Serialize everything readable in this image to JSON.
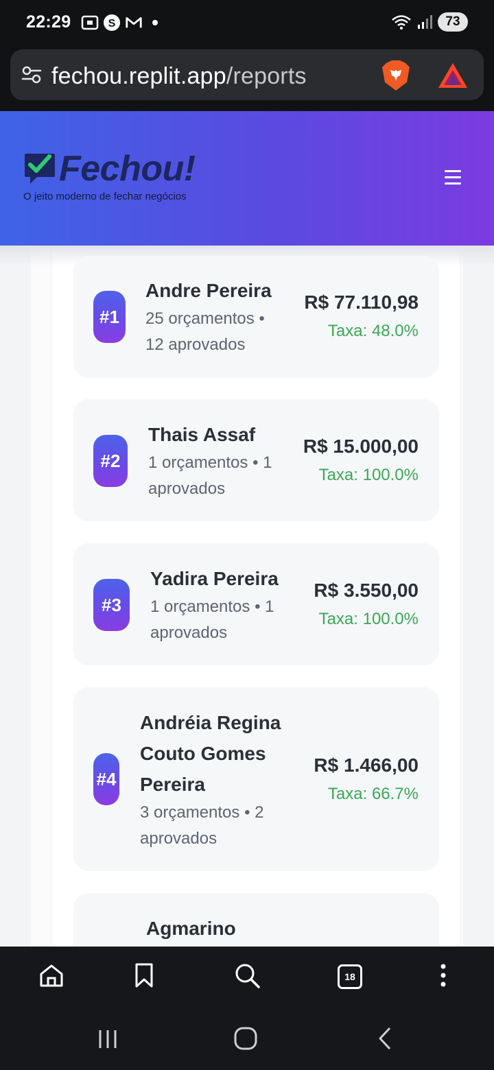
{
  "status_bar": {
    "time": "22:29",
    "battery": "73",
    "icons_left": [
      "screen-record-icon",
      "s-app-icon",
      "gmail-icon"
    ],
    "icons_right": [
      "wifi-icon",
      "signal-icon"
    ]
  },
  "browser": {
    "url_host": "fechou.replit.app",
    "url_path": "/reports",
    "tab_count": "18"
  },
  "app": {
    "logo_text": "Fechou!",
    "tagline": "O jeito moderno de fechar negócios",
    "colors": {
      "header_start": "#3f63e6",
      "header_end": "#7a3be0",
      "rate_green": "#3aa856"
    }
  },
  "ranking": [
    {
      "rank": "#1",
      "name": "Andre Pereira",
      "stats": "25 orçamentos • 12 aprovados",
      "amount": "R$ 77.110,98",
      "rate": "Taxa: 48.0%"
    },
    {
      "rank": "#2",
      "name": "Thais Assaf",
      "stats": "1 orçamentos • 1 aprovados",
      "amount": "R$ 15.000,00",
      "rate": "Taxa: 100.0%"
    },
    {
      "rank": "#3",
      "name": "Yadira Pereira",
      "stats": "1 orçamentos • 1 aprovados",
      "amount": "R$ 3.550,00",
      "rate": "Taxa: 100.0%"
    },
    {
      "rank": "#4",
      "name": "Andréia Regina Couto Gomes Pereira",
      "stats": "3 orçamentos • 2 aprovados",
      "amount": "R$ 1.466,00",
      "rate": "Taxa: 66.7%"
    },
    {
      "rank": "",
      "name": "Agmarino",
      "stats": "",
      "amount": "",
      "rate": ""
    }
  ]
}
